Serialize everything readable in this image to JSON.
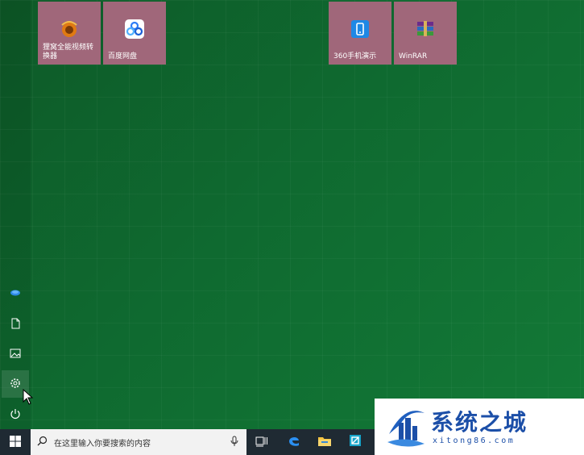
{
  "tiles": [
    {
      "label": "狸窝全能视频转换器",
      "icon": "video-converter-icon"
    },
    {
      "label": "百度网盘",
      "icon": "baidu-netdisk-icon"
    },
    {
      "label": "360手机演示",
      "icon": "phone-demo-icon"
    },
    {
      "label": "WinRAR",
      "icon": "winrar-icon"
    }
  ],
  "left_rail": {
    "items": [
      "user-icon",
      "document-icon",
      "pictures-icon",
      "settings-icon",
      "power-icon"
    ]
  },
  "taskbar": {
    "search_placeholder": "在这里输入你要搜索的内容",
    "icons": [
      "task-view-icon",
      "edge-icon",
      "file-explorer-icon",
      "store-icon"
    ]
  },
  "watermark": {
    "title": "系统之城",
    "subtitle": "xitong86.com"
  },
  "colors": {
    "tile_bg": "#a0677a",
    "desktop_green": "#0f6a30",
    "taskbar": "#1f2a33",
    "brand_blue": "#1c4fa8"
  }
}
